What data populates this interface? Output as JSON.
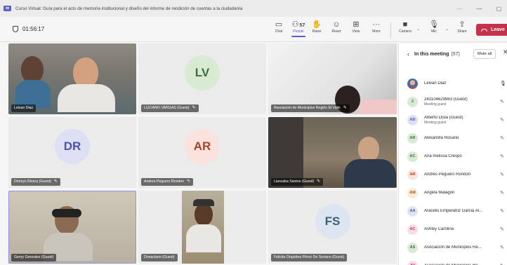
{
  "window": {
    "title": "Curso Virtual: Guía para el acto de memoria institucional y diseño del informe de rendición de cuentas a la ciudadanía",
    "more": "···",
    "minimize": "—",
    "restore": "▢"
  },
  "toolbar": {
    "timer": "01:56:17",
    "buttons": [
      {
        "label": "Chat",
        "icon": "chat-icon"
      },
      {
        "label": "People",
        "icon": "people-icon",
        "count": "57"
      },
      {
        "label": "Raise",
        "icon": "raise-hand-icon"
      },
      {
        "label": "React",
        "icon": "react-icon"
      },
      {
        "label": "View",
        "icon": "view-icon"
      },
      {
        "label": "More",
        "icon": "more-icon"
      },
      {
        "label": "Camera",
        "icon": "camera-icon"
      },
      {
        "label": "Mic",
        "icon": "mic-icon"
      },
      {
        "label": "Share",
        "icon": "share-icon"
      }
    ],
    "leave_label": "Leave"
  },
  "tiles": [
    {
      "name": "Leivan Diaz"
    },
    {
      "name": "LUCIANO VARGAS (Guest)",
      "initials": "LV"
    },
    {
      "name": "Asociación de Municipios Región El Valle"
    },
    {
      "name": "Dennys Rivera (Guest)",
      "initials": "DR"
    },
    {
      "name": "Andres Peguero Rondon",
      "initials": "AR"
    },
    {
      "name": "Lianuska Santos (Guest)"
    },
    {
      "name": "Genry Gonzalez (Guest)"
    },
    {
      "name": "Donaciano (Guest)"
    },
    {
      "name": "Felicita Orquidea Pérez De Soriano (Guest)",
      "initials": "FS"
    }
  ],
  "panel": {
    "title": "In this meeting",
    "count": "(57)",
    "mute_all": "Mute all",
    "participants": [
      {
        "name": "Leivan Diaz",
        "sub": "",
        "initials": "",
        "color": "#c04a2e",
        "bg": "#f3d4c8"
      },
      {
        "name": "243104629963 (Guest)",
        "sub": "Meeting guest",
        "initials": "2",
        "color": "#386f3e",
        "bg": "#d9ead3"
      },
      {
        "name": "Alberto Disla (Guest)",
        "sub": "Meeting guest",
        "initials": "AD",
        "color": "#4f52a9",
        "bg": "#dddff4"
      },
      {
        "name": "Alexandra Rosario",
        "sub": "",
        "initials": "AR",
        "color": "#386f3e",
        "bg": "#d9ead3"
      },
      {
        "name": "Ana melissa Crespo",
        "sub": "",
        "initials": "AC",
        "color": "#386f3e",
        "bg": "#d9ead3"
      },
      {
        "name": "Andres Peguero Rondon",
        "sub": "",
        "initials": "AR",
        "color": "#a8432b",
        "bg": "#fbe3dd"
      },
      {
        "name": "Angela Malagón",
        "sub": "",
        "initials": "AM",
        "color": "#a8581d",
        "bg": "#fbe8d5"
      },
      {
        "name": "Aracelis Emperatriz Garcia Al...",
        "sub": "",
        "initials": "AA",
        "color": "#3f5d7a",
        "bg": "#dde6f0"
      },
      {
        "name": "Ashley Carolina",
        "sub": "",
        "initials": "AC",
        "color": "#a83b6a",
        "bg": "#f6dde8"
      },
      {
        "name": "Asociación de Municipios Re...",
        "sub": "",
        "initials": "AS",
        "color": "#386f3e",
        "bg": "#d9ead3"
      },
      {
        "name": "Asociación de Municipios Re...",
        "sub": "",
        "initials": "AV",
        "color": "#a83b6a",
        "bg": "#f6dde8"
      }
    ]
  }
}
